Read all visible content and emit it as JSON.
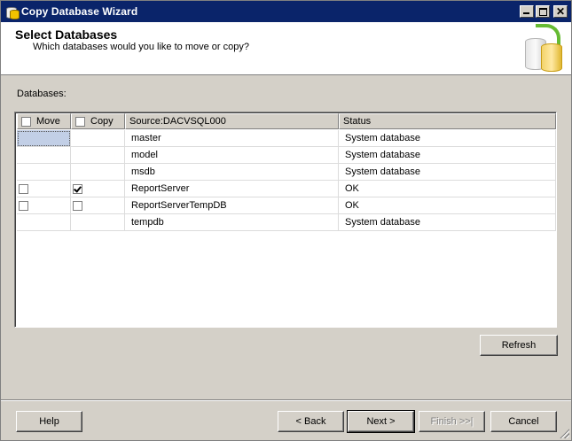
{
  "window": {
    "title": "Copy Database Wizard"
  },
  "header": {
    "title": "Select Databases",
    "subtitle": "Which databases would you like to move or copy?"
  },
  "databases_label": "Databases:",
  "grid": {
    "columns": {
      "move": "Move",
      "copy": "Copy",
      "source": "Source:DACVSQL000",
      "status": "Status"
    },
    "rows": [
      {
        "name": "master",
        "status": "System database",
        "has_checkboxes": false,
        "move": false,
        "copy": false
      },
      {
        "name": "model",
        "status": "System database",
        "has_checkboxes": false,
        "move": false,
        "copy": false
      },
      {
        "name": "msdb",
        "status": "System database",
        "has_checkboxes": false,
        "move": false,
        "copy": false
      },
      {
        "name": "ReportServer",
        "status": "OK",
        "has_checkboxes": true,
        "move": false,
        "copy": true
      },
      {
        "name": "ReportServerTempDB",
        "status": "OK",
        "has_checkboxes": true,
        "move": false,
        "copy": false
      },
      {
        "name": "tempdb",
        "status": "System database",
        "has_checkboxes": false,
        "move": false,
        "copy": false
      }
    ]
  },
  "buttons": {
    "refresh": "Refresh",
    "help": "Help",
    "back": "< Back",
    "next": "Next >",
    "finish": "Finish >>|",
    "cancel": "Cancel"
  }
}
